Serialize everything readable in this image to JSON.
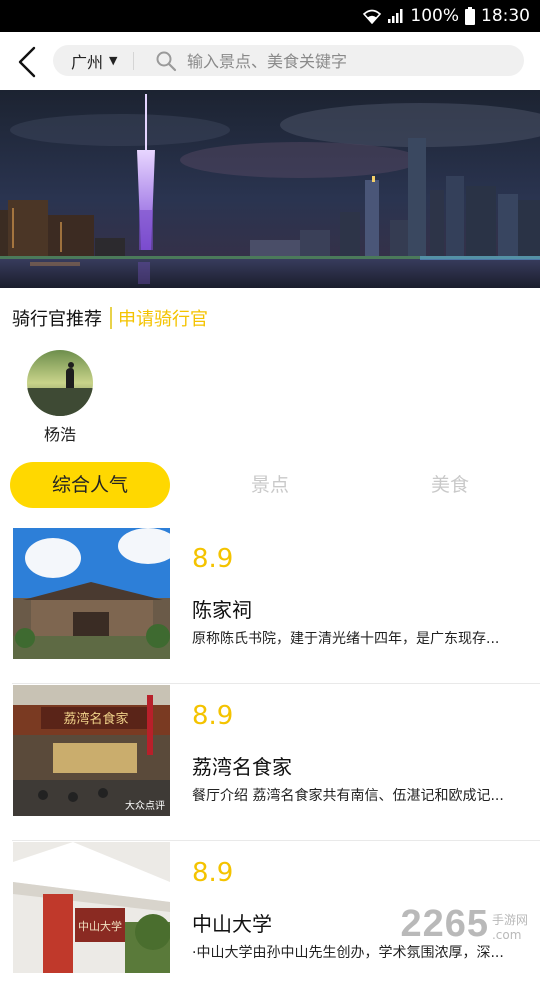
{
  "status_bar": {
    "battery": "100%",
    "time": "18:30"
  },
  "header": {
    "city": "广州",
    "search_placeholder": "输入景点、美食关键字"
  },
  "section": {
    "title": "骑行官推荐",
    "apply_link": "申请骑行官"
  },
  "guides": [
    {
      "name": "杨浩"
    }
  ],
  "tabs": [
    {
      "label": "综合人气",
      "active": true
    },
    {
      "label": "景点",
      "active": false
    },
    {
      "label": "美食",
      "active": false
    }
  ],
  "items": [
    {
      "score": "8.9",
      "title": "陈家祠",
      "desc": "原称陈氏书院，建于清光绪十四年，是广东现存..."
    },
    {
      "score": "8.9",
      "title": "荔湾名食家",
      "desc": "餐厅介绍 荔湾名食家共有南信、伍湛记和欧成记...",
      "thumb_overlay": "大众点评",
      "sign_text": "荔湾名食家"
    },
    {
      "score": "8.9",
      "title": "中山大学",
      "desc": "·中山大学由孙中山先生创办，学术氛围浓厚，深...",
      "sign_text": "中山大学"
    }
  ],
  "watermark": {
    "number": "2265",
    "suffix": "手游网",
    "domain": ".com"
  },
  "colors": {
    "accent": "#ffd800",
    "score": "#f4c300",
    "link": "#f4c300"
  }
}
